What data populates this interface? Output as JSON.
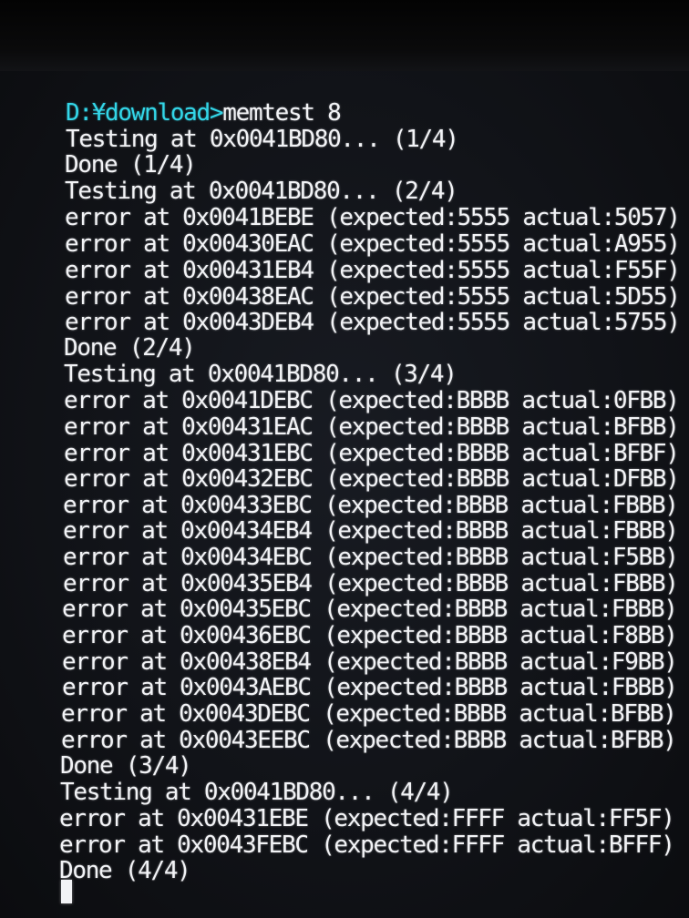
{
  "terminal": {
    "prompt_path": "D:¥download>",
    "command": "memtest 8",
    "lines": [
      "Testing at 0x0041BD80... (1/4)",
      "Done (1/4)",
      "Testing at 0x0041BD80... (2/4)",
      "error at 0x0041BEBE (expected:5555 actual:5057)",
      "error at 0x00430EAC (expected:5555 actual:A955)",
      "error at 0x00431EB4 (expected:5555 actual:F55F)",
      "error at 0x00438EAC (expected:5555 actual:5D55)",
      "error at 0x0043DEB4 (expected:5555 actual:5755)",
      "Done (2/4)",
      "Testing at 0x0041BD80... (3/4)",
      "error at 0x0041DEBC (expected:BBBB actual:0FBB)",
      "error at 0x00431EAC (expected:BBBB actual:BFBB)",
      "error at 0x00431EBC (expected:BBBB actual:BFBF)",
      "error at 0x00432EBC (expected:BBBB actual:DFBB)",
      "error at 0x00433EBC (expected:BBBB actual:FBBB)",
      "error at 0x00434EB4 (expected:BBBB actual:FBBB)",
      "error at 0x00434EBC (expected:BBBB actual:F5BB)",
      "error at 0x00435EB4 (expected:BBBB actual:FBBB)",
      "error at 0x00435EBC (expected:BBBB actual:FBBB)",
      "error at 0x00436EBC (expected:BBBB actual:F8BB)",
      "error at 0x00438EB4 (expected:BBBB actual:F9BB)",
      "error at 0x0043AEBC (expected:BBBB actual:FBBB)",
      "error at 0x0043DEBC (expected:BBBB actual:BFBB)",
      "error at 0x0043EEBC (expected:BBBB actual:BFBB)",
      "Done (3/4)",
      "Testing at 0x0041BD80... (4/4)",
      "error at 0x00431EBE (expected:FFFF actual:FF5F)",
      "error at 0x0043FEBC (expected:FFFF actual:BFFF)",
      "Done (4/4)"
    ]
  },
  "colors": {
    "background": "#111318",
    "text": "#f2f3f6",
    "prompt": "#33d6e8"
  }
}
